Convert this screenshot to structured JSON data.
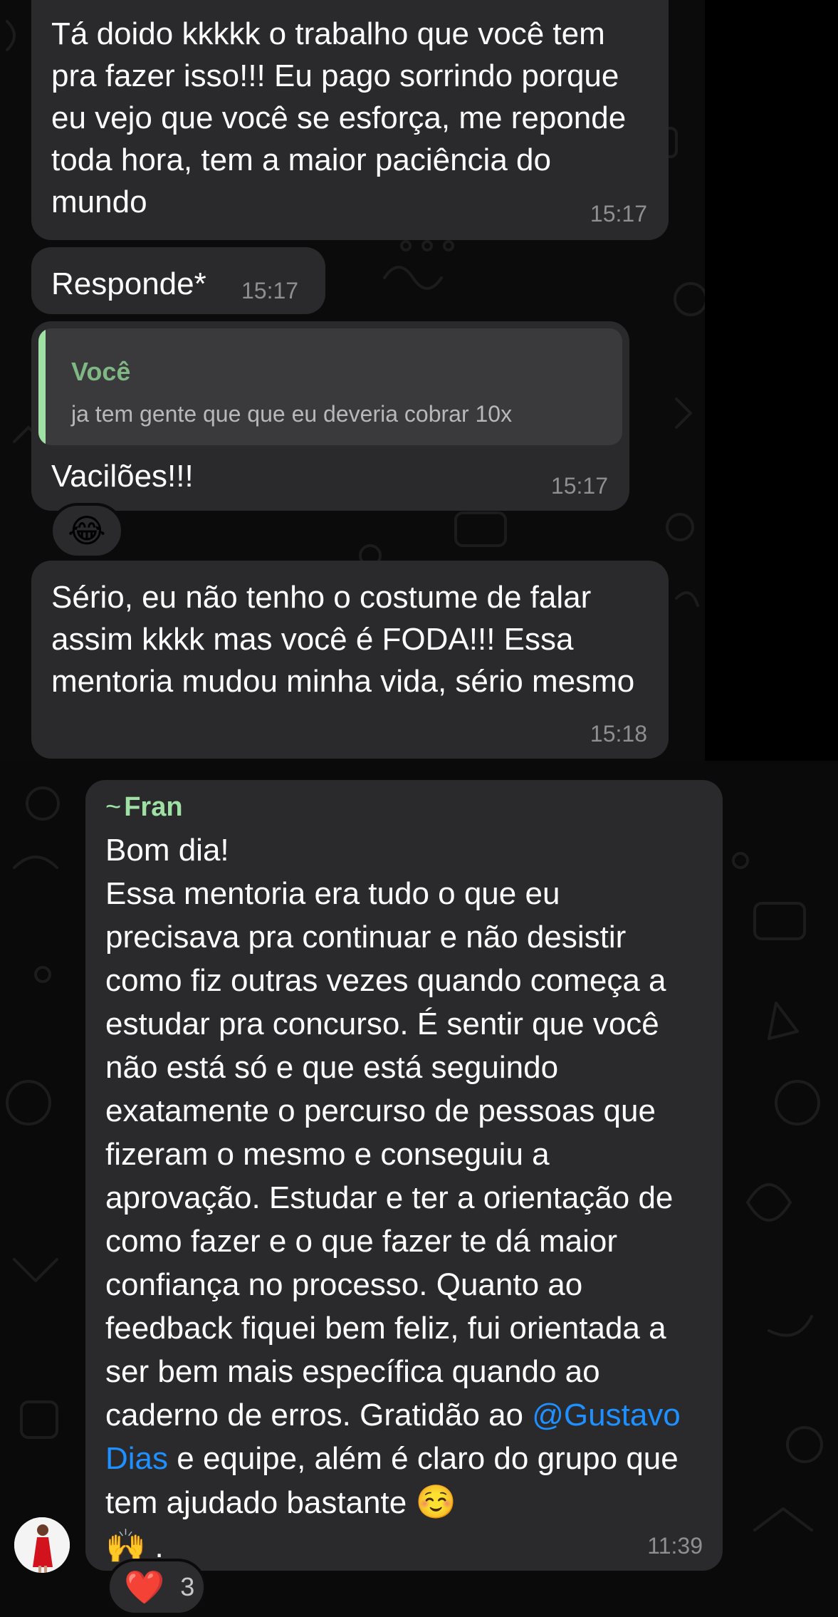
{
  "messages": [
    {
      "text": "Tá doido kkkkk o trabalho que você tem pra fazer isso!!! Eu pago sorrindo porque eu vejo que você se esforça, me reponde toda hora, tem a maior paciência do mundo",
      "time": "15:17"
    },
    {
      "text": "Responde*",
      "time": "15:17"
    },
    {
      "quote": {
        "author": "Você",
        "text": "ja tem gente que que eu deveria cobrar 10x"
      },
      "text": "Vacilões!!!",
      "time": "15:17",
      "reaction": {
        "icon": "tears-of-joy-emoji",
        "emoji": "😂"
      }
    },
    {
      "text": "Sério, eu não tenho o costume de falar assim kkkk mas você é FODA!!! Essa mentoria mudou minha vida, sério mesmo",
      "time": "15:18"
    },
    {
      "sender_prefix": "~",
      "sender": "Fran",
      "text_lead": "Bom dia!\nEssa mentoria era tudo o que eu precisava pra continuar e não desistir como fiz outras vezes quando começa a estudar pra concurso. É sentir que você não está só e que está seguindo exatamente o percurso de pessoas que fizeram o mesmo e conseguiu a aprovação. Estudar e ter a orientação de como fazer e o que fazer te dá maior confiança no processo. Quanto ao feedback fiquei bem feliz, fui orientada a ser bem mais específica quando ao caderno de erros. Gratidão ao ",
      "mention": "@Gustavo Dias",
      "text_tail": " e equipe, além é claro do grupo que tem ajudado bastante ",
      "emoji_1": "☺️",
      "emoji_2": "🙌",
      "text_end": " .",
      "time": "11:39",
      "reaction": {
        "icon": "heart-emoji",
        "emoji": "❤️",
        "count": "3"
      }
    }
  ],
  "colors": {
    "bubble": "#2a2a2c",
    "quote_bar": "#9fe0a4",
    "sender_name": "#9fe0a4",
    "mention": "#1e90ff",
    "timestamp": "#8e8e93"
  }
}
